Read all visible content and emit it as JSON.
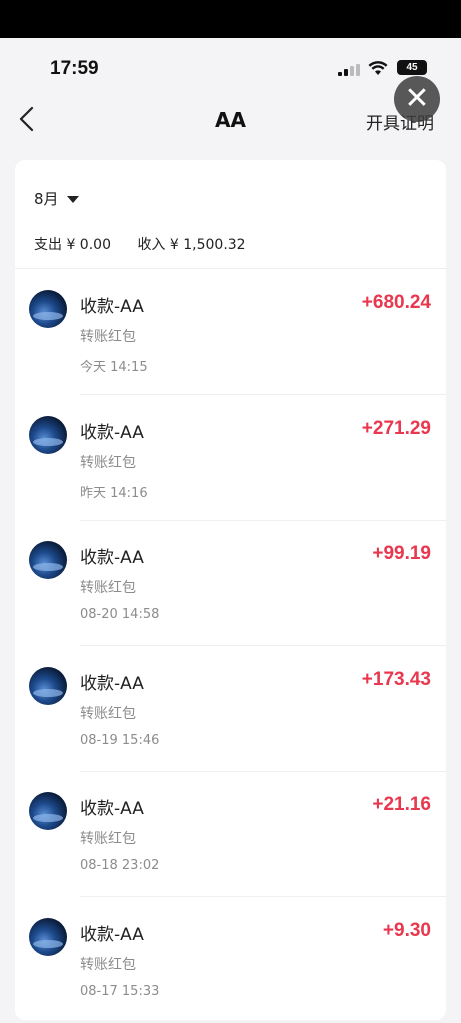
{
  "status": {
    "time": "17:59",
    "battery": "45"
  },
  "nav": {
    "title": "AA",
    "action": "开具证明"
  },
  "filter": {
    "month": "8月"
  },
  "summary": {
    "expense": "支出 ¥ 0.00",
    "income": "收入 ¥ 1,500.32"
  },
  "colors": {
    "amount": "#e8374e",
    "background": "#f4f4f6"
  },
  "transactions": [
    {
      "title": "收款-AA",
      "subtitle": "转账红包",
      "time": "今天 14:15",
      "amount": "+680.24"
    },
    {
      "title": "收款-AA",
      "subtitle": "转账红包",
      "time": "昨天 14:16",
      "amount": "+271.29"
    },
    {
      "title": "收款-AA",
      "subtitle": "转账红包",
      "time": "08-20 14:58",
      "amount": "+99.19"
    },
    {
      "title": "收款-AA",
      "subtitle": "转账红包",
      "time": "08-19 15:46",
      "amount": "+173.43"
    },
    {
      "title": "收款-AA",
      "subtitle": "转账红包",
      "time": "08-18 23:02",
      "amount": "+21.16"
    },
    {
      "title": "收款-AA",
      "subtitle": "转账红包",
      "time": "08-17 15:33",
      "amount": "+9.30"
    }
  ]
}
